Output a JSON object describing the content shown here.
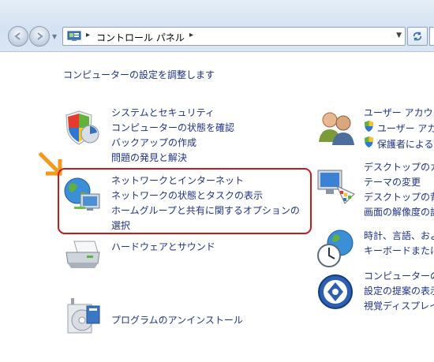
{
  "address_bar": {
    "breadcrumb": "コントロール パネル",
    "separator": "▸"
  },
  "main": {
    "heading": "コンピューターの設定を調整します",
    "left_categories": [
      {
        "title": "システムとセキュリティ",
        "links": [
          "コンピューターの状態を確認",
          "バックアップの作成",
          "問題の発見と解決"
        ],
        "icon": "shield-security-icon"
      },
      {
        "title": "ネットワークとインターネット",
        "links": [
          "ネットワークの状態とタスクの表示",
          "ホームグループと共有に関するオプションの",
          "選択"
        ],
        "icon": "network-globe-icon"
      },
      {
        "title": "ハードウェアとサウンド",
        "links": [],
        "icon": "printer-icon"
      },
      {
        "title": "プログラムのアンインストール",
        "links": [],
        "icon": "programs-icon"
      }
    ],
    "right_categories": [
      {
        "title": "ユーザー アカウ",
        "links": [
          "ユーザー アカ",
          "保護者による"
        ],
        "icon": "users-icon"
      },
      {
        "title": "デスクトップのカ",
        "links": [
          "テーマの変更",
          "デスクトップの背",
          "画面の解像度の設"
        ],
        "icon": "display-palette-icon"
      },
      {
        "title": "時計、言語、およ",
        "links": [
          "キーボードまたに"
        ],
        "icon": "clock-globe-icon"
      },
      {
        "title": "コンピューターの",
        "links": [
          "設定の提案の表示",
          "視覚ディスプレイ"
        ],
        "icon": "ease-of-access-icon"
      }
    ]
  },
  "colors": {
    "link": "#1e3287",
    "highlight": "#c8191c",
    "arrow": "#f39a1e"
  }
}
